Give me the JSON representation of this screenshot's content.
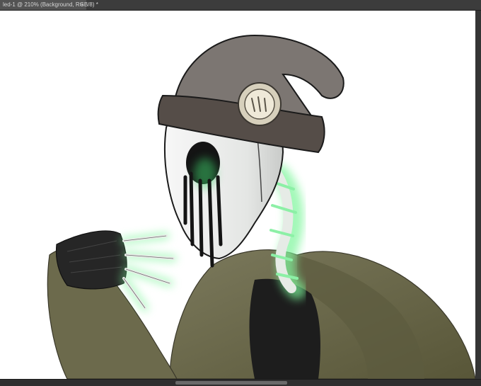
{
  "document": {
    "tab_title": "led-1 @ 210% (Background, RGB/8) *",
    "close_glyph": "×"
  },
  "canvas": {
    "background": "#ffffff",
    "colors": {
      "hat": "#7a7470",
      "hat_band": "#4f4844",
      "skull": "#eef0ee",
      "eye_drip": "#141414",
      "glow": "#7cf59a",
      "hoodie": "#676548",
      "shirt": "#1d1d1d",
      "glove": "#2a2a2a"
    }
  }
}
